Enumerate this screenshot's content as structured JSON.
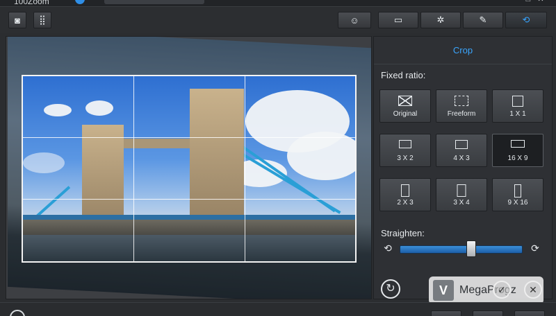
{
  "titlebar": {
    "title_fragment": "100Zoom",
    "controls": [
      "–",
      "□",
      "✕"
    ]
  },
  "toolbar": {
    "left": [
      {
        "icon": "camera-icon",
        "glyph": "◙"
      },
      {
        "icon": "grid-icon",
        "glyph": "⣿"
      }
    ],
    "right": [
      {
        "icon": "face-icon",
        "glyph": "☺"
      },
      {
        "icon": "monitor-icon",
        "glyph": "▭"
      },
      {
        "icon": "adjust-icon",
        "glyph": "✲"
      },
      {
        "icon": "edit-icon",
        "glyph": "✎"
      },
      {
        "icon": "crop-rotate-icon",
        "glyph": "⟲",
        "active": true
      }
    ]
  },
  "panel": {
    "tab_label": "Crop",
    "fixed_ratio_label": "Fixed ratio:",
    "ratios": [
      {
        "label": "Original",
        "icon": "original-ratio-icon",
        "selected": false
      },
      {
        "label": "Freeform",
        "icon": "freeform-ratio-icon",
        "selected": false
      },
      {
        "label": "1 X 1",
        "icon": "square-ratio-icon",
        "selected": false
      },
      {
        "label": "3 X 2",
        "icon": "ratio-3x2-icon",
        "selected": false
      },
      {
        "label": "4 X 3",
        "icon": "ratio-4x3-icon",
        "selected": false
      },
      {
        "label": "16 X 9",
        "icon": "ratio-16x9-icon",
        "selected": true
      },
      {
        "label": "2 X 3",
        "icon": "ratio-2x3-icon",
        "selected": false
      },
      {
        "label": "3 X 4",
        "icon": "ratio-3x4-icon",
        "selected": false
      },
      {
        "label": "9 X 16",
        "icon": "ratio-9x16-icon",
        "selected": false
      }
    ],
    "straighten_label": "Straighten:",
    "straighten_value": 0.58
  },
  "watermark": {
    "text": "MegaProgz",
    "logo_glyph": "V"
  },
  "colors": {
    "accent": "#3aa6ff",
    "slider": "#2a7fcf",
    "panel": "#2e3034"
  }
}
